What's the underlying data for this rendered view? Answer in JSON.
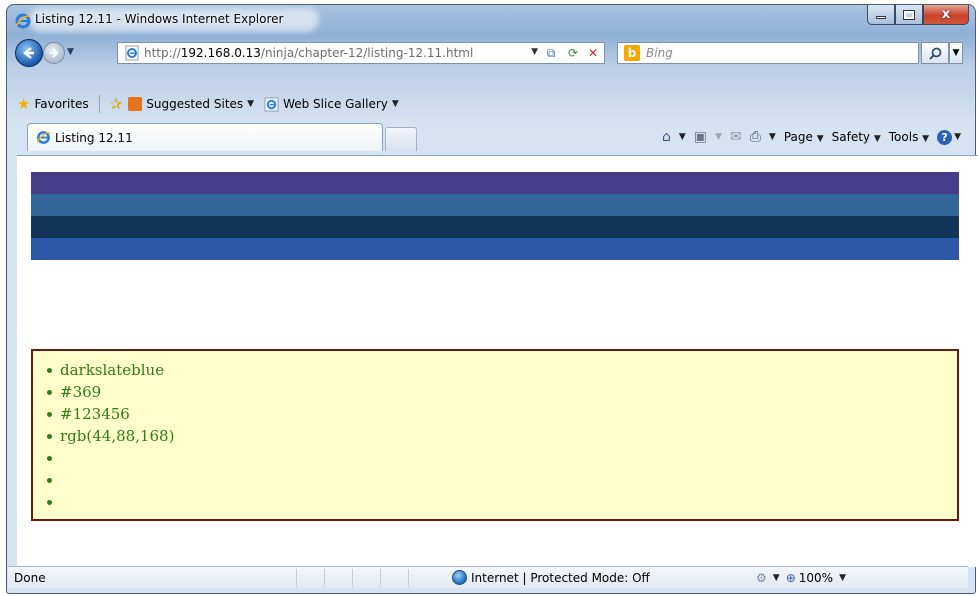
{
  "window": {
    "title": "Listing 12.11 - Windows Internet Explorer",
    "close_glyph": "x"
  },
  "address_bar": {
    "url_prefix": "http://",
    "url_host": "192.168.0.13",
    "url_path": "/ninja/chapter-12/listing-12.11.html"
  },
  "search": {
    "placeholder": "Bing"
  },
  "favorites_bar": {
    "favorites_label": "Favorites",
    "items": [
      {
        "label": "Suggested Sites"
      },
      {
        "label": "Web Slice Gallery"
      }
    ]
  },
  "tab": {
    "label": "Listing 12.11"
  },
  "command_bar": {
    "page_label": "Page",
    "safety_label": "Safety",
    "tools_label": "Tools"
  },
  "content": {
    "stripe_colors": [
      "#483d8b",
      "#336699",
      "#123456",
      "#2c58a8"
    ],
    "box_background": "#ffffcc",
    "box_border": "#6b1a0f",
    "text_color": "#2e7d1a",
    "color_list": [
      "darkslateblue",
      "#369",
      "#123456",
      "rgb(44,88,168)",
      "",
      "",
      ""
    ]
  },
  "status_bar": {
    "status_text": "Done",
    "zone_text": "Internet | Protected Mode: Off",
    "zoom_text": "100%"
  }
}
